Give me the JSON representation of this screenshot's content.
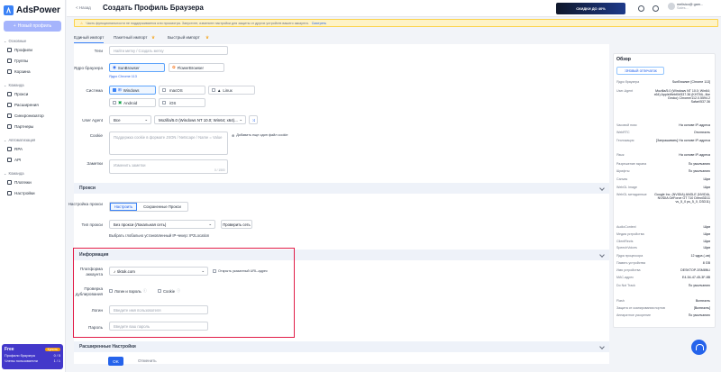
{
  "app": {
    "name": "AdsPower",
    "new_profile": "Новый профиль"
  },
  "sidebar": {
    "sections": [
      {
        "label": "Основные"
      },
      {
        "label": "Команда"
      },
      {
        "label": "Автоматизация"
      },
      {
        "label": "Команда"
      }
    ],
    "items": [
      {
        "label": "Профили"
      },
      {
        "label": "Группы"
      },
      {
        "label": "Корзина"
      },
      {
        "label": "Прокси"
      },
      {
        "label": "Расширения"
      },
      {
        "label": "Синхронизатор"
      },
      {
        "label": "Партнеры"
      },
      {
        "label": "RPA"
      },
      {
        "label": "API"
      },
      {
        "label": "Платежи"
      },
      {
        "label": "Настройки"
      }
    ],
    "plan": {
      "name": "Free",
      "badge": "Купить",
      "rows": [
        {
          "k": "Профили браузера",
          "v": "0 / 5"
        },
        {
          "k": "Члены пользователи",
          "v": "1 / 1"
        }
      ]
    }
  },
  "header": {
    "back": "< Назад",
    "title": "Создать Профиль Браузера",
    "ad": "СКИДКИ ДО 40%",
    "user": "melisico@ gam...",
    "user_sub": "Sales..."
  },
  "banner": {
    "text": "Часть функциональности не поддерживается или просмотра. Запустите, измените настройки для защиты от других устройств вашего аккаунта.",
    "link": "Смотреть"
  },
  "tabs": [
    {
      "label": "Единый импорт"
    },
    {
      "label": "Пакетный импорт"
    },
    {
      "label": "Быстрый импорт"
    }
  ],
  "form": {
    "tags": {
      "label": "Теги",
      "placeholder": "Найти метку / Создать метку"
    },
    "kernel": {
      "label": "Ядро браузера",
      "opt1": "SunBrowser",
      "opt2": "FlowerBrowser",
      "sub": "Ядро Chrome 113"
    },
    "system": {
      "label": "Система",
      "os": [
        "Windows",
        "macOS",
        "Linux",
        "Android",
        "iOS"
      ]
    },
    "ua": {
      "label": "User Agent",
      "select": "Все",
      "value": "Mozilla/5.0 (Windows NT 10.0; Win64; x64)..."
    },
    "cookie": {
      "label": "Cookie",
      "placeholder": "Поддержка cookie в формате JSON / Netscape / Name = Value",
      "extra": "Добавить еще один файл cookie"
    },
    "notes": {
      "label": "Заметки",
      "placeholder": "Изменить заметки",
      "count": "0 / 1500"
    }
  },
  "proxy": {
    "title": "Прокси",
    "setting_label": "Настройка прокси",
    "tab1": "Настроить",
    "tab2": "Сохраненные Прокси",
    "type_label": "Тип прокси",
    "type_value": "Без прокси (Локальная сеть)",
    "check": "Проверить сеть",
    "note": "Выбрать глобально установленный IP-чекер: IP2Location"
  },
  "info": {
    "title": "Информация",
    "platform_label": "Платформа аккаунта",
    "platform_value": "tiktok.com",
    "open_url": "Открыть указанный URL-адрес",
    "dup_label": "Проверка дублирования",
    "dup1": "Логин и пароль",
    "dup2": "Cookie",
    "login_label": "Логин",
    "login_ph": "Введите имя пользователя",
    "pass_label": "Пароль",
    "pass_ph": "Введите ваш пароль"
  },
  "advanced": {
    "title": "Расширенные Настройки"
  },
  "footer": {
    "ok": "OK",
    "cancel": "Отменить"
  },
  "overview": {
    "title": "Обзор",
    "new_fp": "Новый отпечаток",
    "rows": [
      {
        "k": "Ядро браузера",
        "v": "SunBrowser [Chrome 113]"
      },
      {
        "k": "User-Agent",
        "v": "Mozilla/5.0 (Windows NT 10.0; Win64; x64) AppleWebKit/537.36 (KHTML, like Gecko) Chrome/112.0.5594.2 Safari/537.36"
      },
      {
        "k": "Часовой пояс",
        "v": "На основе IP-адреса"
      },
      {
        "k": "WebRTC",
        "v": "Отключить"
      },
      {
        "k": "Геолокация",
        "v": "[Запрашивать] На основе IP-адреса"
      },
      {
        "k": "Язык",
        "v": "На основе IP-адреса"
      },
      {
        "k": "Разрешение экрана",
        "v": "По умолчанию"
      },
      {
        "k": "Шрифты",
        "v": "По умолчанию"
      },
      {
        "k": "Canvas",
        "v": "Шум"
      },
      {
        "k": "WebGL Image",
        "v": "Шум"
      },
      {
        "k": "WebGL метаданные",
        "v": "Google Inc. (NVIDIA) ANGLE (NVIDIA, NVIDIA GeForce GT 710 Direct3D11 vs_5_0 ps_5_0, D3D11)"
      },
      {
        "k": "AudioContext",
        "v": "Шум"
      },
      {
        "k": "Медиа устройства",
        "v": "Шум"
      },
      {
        "k": "ClientRects",
        "v": "Шум"
      },
      {
        "k": "SpeechVoices",
        "v": "Шум"
      },
      {
        "k": "Ядра процессора",
        "v": "12 ядра (-ов)"
      },
      {
        "k": "Память устройства",
        "v": "8 GB"
      },
      {
        "k": "Имя устройства",
        "v": "DESKTOP-3SM8NU"
      },
      {
        "k": "MAC-адрес",
        "v": "E4-54-47-45-3F-8B"
      },
      {
        "k": "Do Not Track",
        "v": "По умолчанию"
      },
      {
        "k": "Flash",
        "v": "Включить"
      },
      {
        "k": "Защита от сканирования портов",
        "v": "[Включить]"
      },
      {
        "k": "Аппаратное ускорение",
        "v": "По умолчанию"
      }
    ]
  },
  "colors": {
    "accent": "#2563eb",
    "highlight": "#e11d48"
  }
}
